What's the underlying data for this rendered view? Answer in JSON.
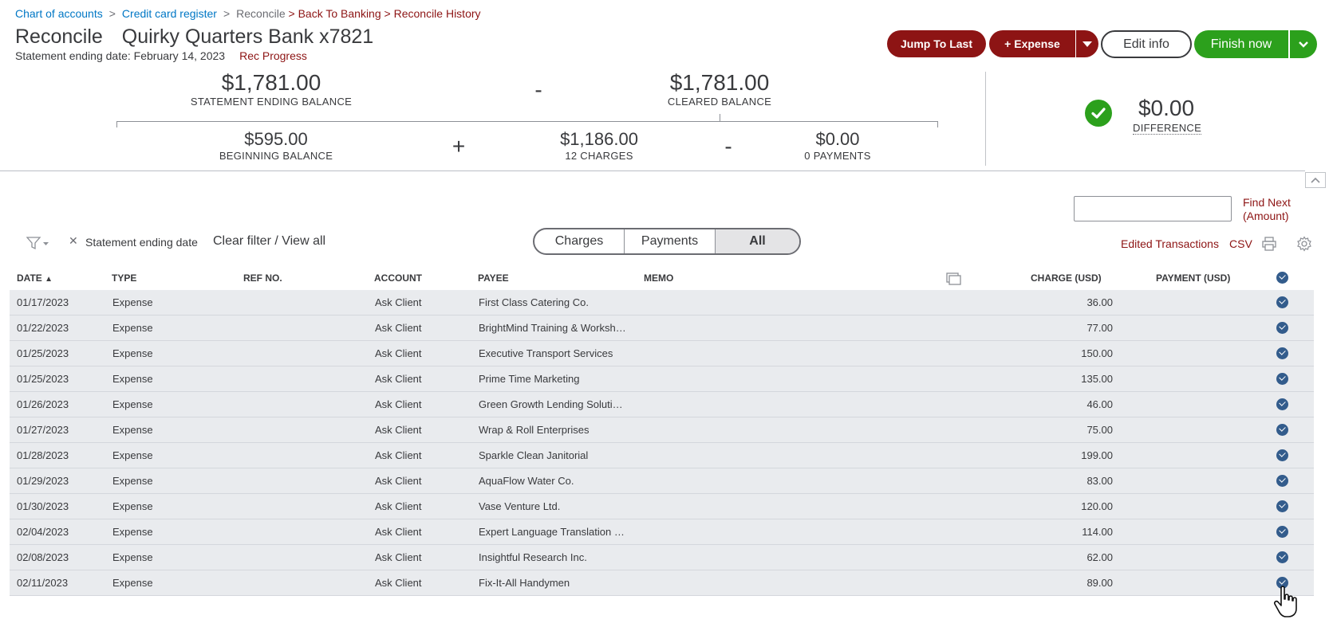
{
  "breadcrumb": {
    "chart_of_accounts": "Chart of accounts",
    "credit_card_register": "Credit card register",
    "reconcile": "Reconcile",
    "back_to_banking": "> Back To Banking",
    "reconcile_history": "> Reconcile History",
    "separator": ">"
  },
  "header": {
    "title": "Reconcile",
    "account": "Quirky Quarters Bank x7821",
    "statement_date": "Statement ending date: February 14, 2023",
    "rec_progress": "Rec Progress"
  },
  "actions": {
    "jump_to_last": "Jump To Last",
    "expense": "+ Expense",
    "edit_info": "Edit info",
    "finish_now": "Finish now"
  },
  "summary": {
    "statement_ending_balance": "$1,781.00",
    "statement_ending_balance_label": "STATEMENT ENDING BALANCE",
    "cleared_balance": "$1,781.00",
    "cleared_balance_label": "CLEARED BALANCE",
    "beginning_balance": "$595.00",
    "beginning_balance_label": "BEGINNING BALANCE",
    "charges_total": "$1,186.00",
    "charges_label": "12 CHARGES",
    "payments_total": "$0.00",
    "payments_label": "0 PAYMENTS",
    "difference": "$0.00",
    "difference_label": "DIFFERENCE",
    "op_minus": "-",
    "op_plus": "+",
    "colors": {
      "success": "#2ca01c",
      "brand_red": "#8d1414",
      "link": "#0077c5"
    }
  },
  "find": {
    "placeholder": "",
    "find_next": "Find Next",
    "find_next_sub": "(Amount)"
  },
  "filter": {
    "chip_label": "Statement ending date",
    "clear_filter": "Clear filter / View all",
    "segments": [
      "Charges",
      "Payments",
      "All"
    ],
    "selected": "All",
    "edited_transactions": "Edited Transactions",
    "csv": "CSV"
  },
  "table": {
    "columns": {
      "date": "DATE",
      "type": "TYPE",
      "ref_no": "REF NO.",
      "account": "ACCOUNT",
      "payee": "PAYEE",
      "memo": "MEMO",
      "charge": "CHARGE (USD)",
      "payment": "PAYMENT (USD)"
    },
    "rows": [
      {
        "date": "01/17/2023",
        "type": "Expense",
        "ref": "",
        "account": "Ask Client",
        "payee": "First Class Catering Co.",
        "memo": "",
        "charge": "36.00",
        "payment": ""
      },
      {
        "date": "01/22/2023",
        "type": "Expense",
        "ref": "",
        "account": "Ask Client",
        "payee": "BrightMind Training & Worksh…",
        "memo": "",
        "charge": "77.00",
        "payment": ""
      },
      {
        "date": "01/25/2023",
        "type": "Expense",
        "ref": "",
        "account": "Ask Client",
        "payee": "Executive Transport Services",
        "memo": "",
        "charge": "150.00",
        "payment": ""
      },
      {
        "date": "01/25/2023",
        "type": "Expense",
        "ref": "",
        "account": "Ask Client",
        "payee": "Prime Time Marketing",
        "memo": "",
        "charge": "135.00",
        "payment": ""
      },
      {
        "date": "01/26/2023",
        "type": "Expense",
        "ref": "",
        "account": "Ask Client",
        "payee": "Green Growth Lending Soluti…",
        "memo": "",
        "charge": "46.00",
        "payment": ""
      },
      {
        "date": "01/27/2023",
        "type": "Expense",
        "ref": "",
        "account": "Ask Client",
        "payee": "Wrap & Roll Enterprises",
        "memo": "",
        "charge": "75.00",
        "payment": ""
      },
      {
        "date": "01/28/2023",
        "type": "Expense",
        "ref": "",
        "account": "Ask Client",
        "payee": "Sparkle Clean Janitorial",
        "memo": "",
        "charge": "199.00",
        "payment": ""
      },
      {
        "date": "01/29/2023",
        "type": "Expense",
        "ref": "",
        "account": "Ask Client",
        "payee": "AquaFlow Water Co.",
        "memo": "",
        "charge": "83.00",
        "payment": ""
      },
      {
        "date": "01/30/2023",
        "type": "Expense",
        "ref": "",
        "account": "Ask Client",
        "payee": "Vase Venture Ltd.",
        "memo": "",
        "charge": "120.00",
        "payment": ""
      },
      {
        "date": "02/04/2023",
        "type": "Expense",
        "ref": "",
        "account": "Ask Client",
        "payee": "Expert Language Translation …",
        "memo": "",
        "charge": "114.00",
        "payment": ""
      },
      {
        "date": "02/08/2023",
        "type": "Expense",
        "ref": "",
        "account": "Ask Client",
        "payee": "Insightful Research Inc.",
        "memo": "",
        "charge": "62.00",
        "payment": ""
      },
      {
        "date": "02/11/2023",
        "type": "Expense",
        "ref": "",
        "account": "Ask Client",
        "payee": "Fix-It-All Handymen",
        "memo": "",
        "charge": "89.00",
        "payment": ""
      }
    ]
  }
}
